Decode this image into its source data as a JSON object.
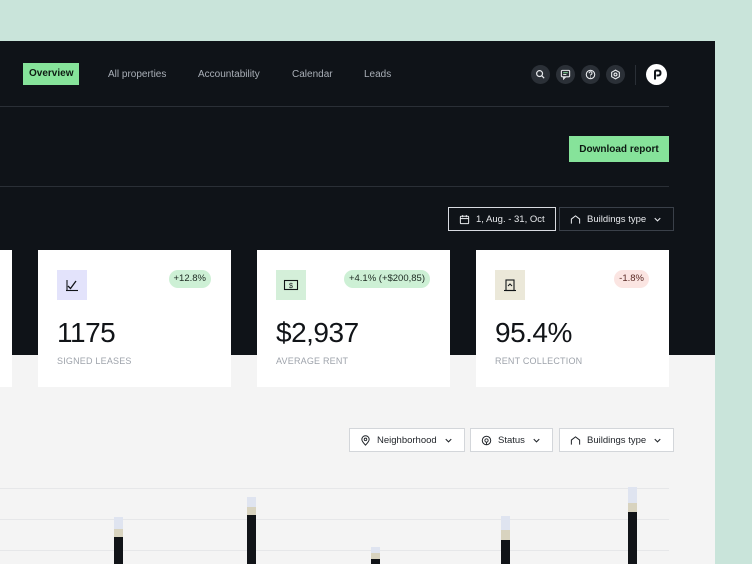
{
  "nav": {
    "items": [
      {
        "label": "Overview",
        "active": true
      },
      {
        "label": "All properties"
      },
      {
        "label": "Accountability"
      },
      {
        "label": "Calendar"
      },
      {
        "label": "Leads"
      }
    ],
    "icons": [
      "search-icon",
      "chat-icon",
      "help-icon",
      "settings-icon"
    ],
    "logo_icon": "brand-logo"
  },
  "header": {
    "download_label": "Download report"
  },
  "filters_top": {
    "date_range": "1, Aug. - 31, Oct",
    "buildings_type": "Buildings type"
  },
  "cards": [
    {
      "value": "1175",
      "caption": "SIGNED LEASES",
      "badge": "+12.8%",
      "badge_kind": "positive",
      "icon": "signature-icon"
    },
    {
      "value": "$2,937",
      "caption": "AVERAGE RENT",
      "badge": "+4.1% (+$200,85)",
      "badge_kind": "positive",
      "icon": "dollar-bill-icon"
    },
    {
      "value": "95.4%",
      "caption": "RENT COLLECTION",
      "badge": "-1.8%",
      "badge_kind": "negative",
      "icon": "collection-icon"
    }
  ],
  "filters_bottom": {
    "neighborhood": "Neighborhood",
    "status": "Status",
    "buildings_type": "Buildings type"
  },
  "colors": {
    "accent": "#86e39a",
    "dark_bg": "#0f1318",
    "bar_dark": "#111418",
    "bar_beige": "#d8d3bf",
    "bar_blue": "#dfe4f0"
  }
}
